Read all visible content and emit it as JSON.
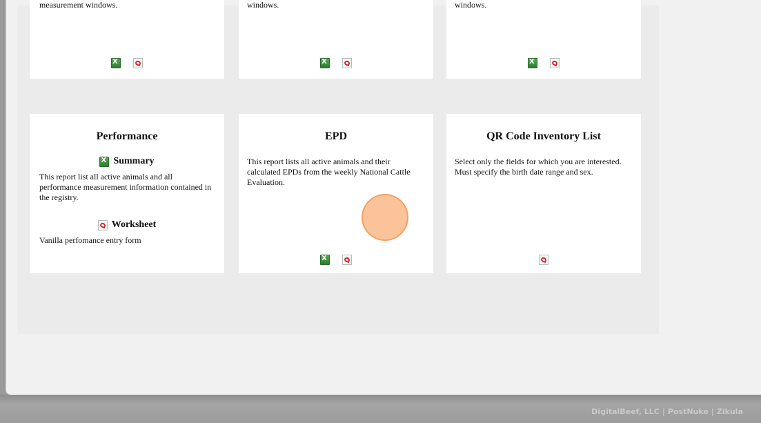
{
  "top_row": [
    {
      "text_tail": "measurement windows."
    },
    {
      "text_tail": "windows."
    },
    {
      "text_tail": "windows."
    }
  ],
  "cards": {
    "performance": {
      "title": "Performance",
      "summary_label": "Summary",
      "summary_desc": "This report list all active animals and all performance measurement information contained in the registry.",
      "worksheet_label": "Worksheet",
      "worksheet_desc": "Vanilla perfomance entry form"
    },
    "epd": {
      "title": "EPD",
      "desc": "This report lists all active animals and their calculated EPDs from the weekly National Cattle Evaluation."
    },
    "qr": {
      "title": "QR Code Inventory List",
      "desc": "Select only the fields for which you are interested. Must specify the birth date range and sex."
    }
  },
  "footer": {
    "link1": "DigitalBeef, LLC",
    "link2": "PostNuke",
    "link3": "Zikula",
    "separator": "|"
  },
  "icons": {
    "excel": "excel-icon",
    "pdf": "pdf-icon"
  },
  "colors": {
    "excel_green": "#3a8a3a",
    "pdf_red": "#d02a2a",
    "click_indicator": "#f9a870"
  }
}
